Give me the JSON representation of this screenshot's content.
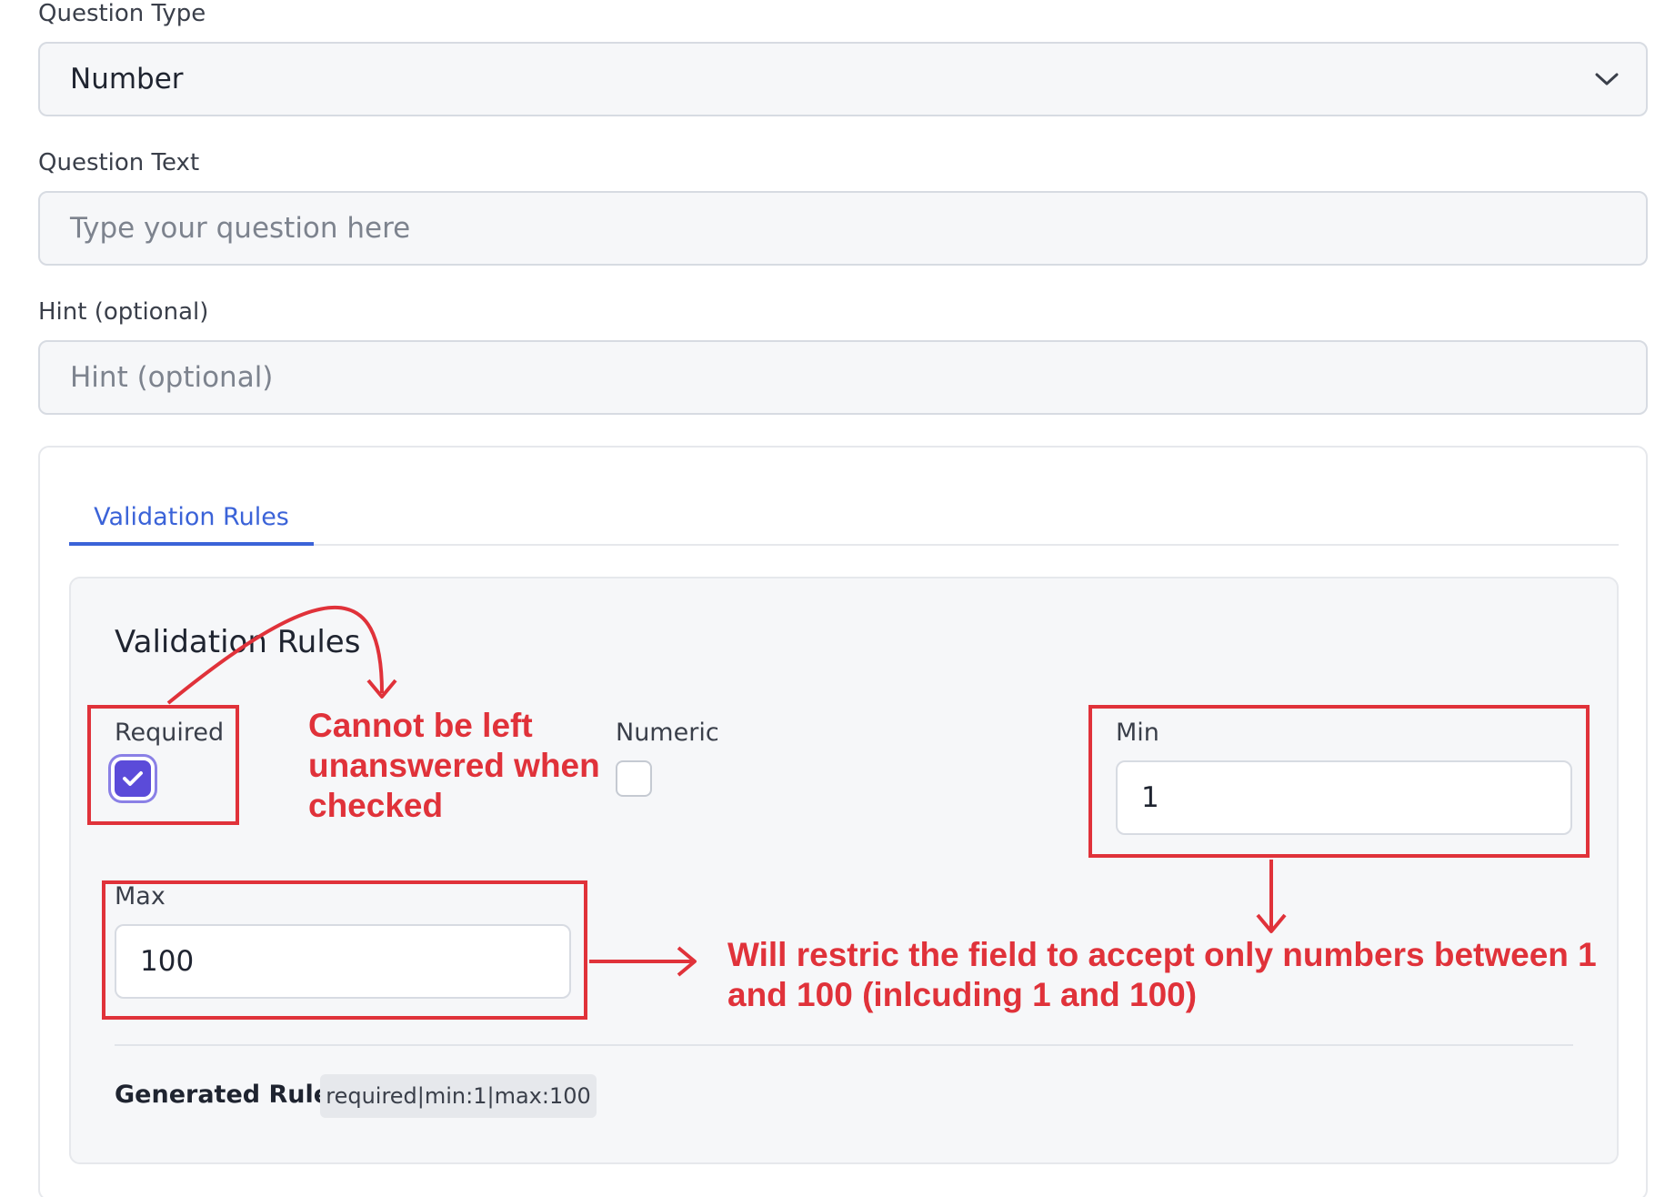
{
  "question_type": {
    "label": "Question Type",
    "value": "Number"
  },
  "question_text": {
    "label": "Question Text",
    "placeholder": "Type your question here"
  },
  "hint": {
    "label": "Hint (optional)",
    "placeholder": "Hint (optional)"
  },
  "tabs": [
    {
      "label": "Validation Rules",
      "active": true
    }
  ],
  "validation": {
    "title": "Validation Rules",
    "required": {
      "label": "Required",
      "checked": true
    },
    "numeric": {
      "label": "Numeric",
      "checked": false
    },
    "min": {
      "label": "Min",
      "value": "1"
    },
    "max": {
      "label": "Max",
      "value": "100"
    },
    "generated_rule_label": "Generated Rule:",
    "generated_rule_value": "required|min:1|max:100"
  },
  "annotations": {
    "required_note": [
      "Cannot be left",
      "unanswered when",
      "checked"
    ],
    "range_note": [
      "Will restric the field to accept only numbers between 1",
      "and 100 (inlcuding 1 and 100)"
    ]
  },
  "colors": {
    "accent": "#3b63d8",
    "checkbox_checked": "#5b4bd9",
    "annotation": "#e0323a"
  },
  "icons": {
    "select_toggle": "chevron-down-icon",
    "checkmark": "check-icon"
  }
}
